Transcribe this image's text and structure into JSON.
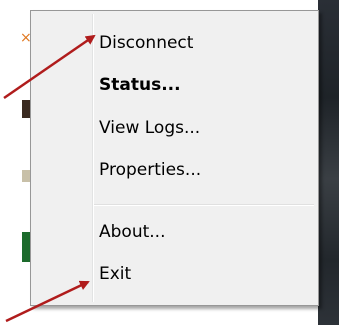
{
  "menu": {
    "items": [
      {
        "label": "Disconnect",
        "bold": false
      },
      {
        "label": "Status...",
        "bold": true
      },
      {
        "label": "View Logs...",
        "bold": false
      },
      {
        "label": "Properties...",
        "bold": false
      },
      {
        "label": "About...",
        "bold": false
      },
      {
        "label": "Exit",
        "bold": false
      }
    ]
  },
  "colors": {
    "menu_background": "#f0f0f0",
    "menu_border": "#979797",
    "arrow": "#b01c1c",
    "desktop_right": "#2a2f36"
  },
  "icons": {
    "annotation_arrow_1": "arrow-icon",
    "annotation_arrow_2": "arrow-icon"
  }
}
